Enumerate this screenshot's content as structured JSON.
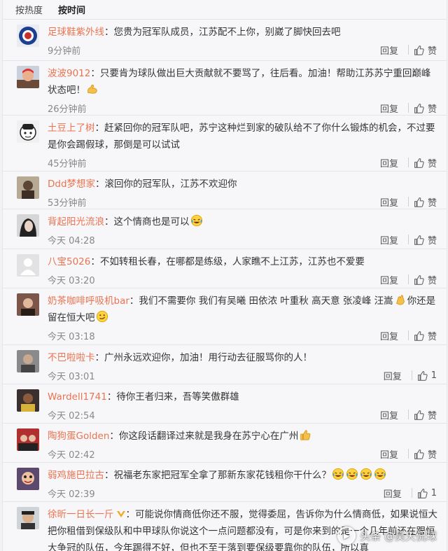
{
  "sort_tabs": [
    "按热度",
    "按时间"
  ],
  "labels": {
    "reply": "回复",
    "like": "赞"
  },
  "comments": [
    {
      "user": "足球鞋紫外线",
      "text": "您贵为冠军队成员，江苏配不上你，别崴了脚快回去吧",
      "time": "9分钟前",
      "likes": ""
    },
    {
      "user": "波波9012",
      "text": "只要肯为球队做出巨大贡献就不要骂了，往后看。加油！帮助江苏苏宁重回巅峰状态吧！",
      "time": "26分钟前",
      "likes": ""
    },
    {
      "user": "土豆上了树",
      "text": "赶紧回你的冠军队吧，苏宁这种烂到家的破队给不了你什么锻炼的机会，不过要是你会踢假球，那倒是可以试试",
      "time": "45分钟前",
      "likes": ""
    },
    {
      "user": "Ddd梦想家",
      "text": "滚回你的冠军队，江苏不欢迎你",
      "time": "53分钟前",
      "likes": ""
    },
    {
      "user": "背起阳光流浪",
      "text": "这个情商也是可以",
      "time": "今天 04:28",
      "likes": ""
    },
    {
      "user": "八宝5026",
      "text": "不如转租长春，在哪都是练级，人家瞧不上江苏，江苏也不爱要",
      "time": "今天 03:20",
      "likes": ""
    },
    {
      "user": "奶茶咖啡呼吸机bar",
      "text": "我们不需要你 我们有吴曦 田依浓 叶重秋 高天意 张凌峰 汪嵩",
      "text2": "你还是留在恒大吧",
      "time": "今天 03:18",
      "likes": ""
    },
    {
      "user": "不巴啦啦卡",
      "text": "广州永远欢迎你，加油！用行动去征服骂你的人！",
      "time": "今天 03:01",
      "likes": "1"
    },
    {
      "user": "Wardell1741",
      "text": "待你王者归来，吾等笑傲群雄",
      "time": "今天 02:54",
      "likes": ""
    },
    {
      "user": "陶狗蛋Golden",
      "text": "你这段话翻译过来就是我身在苏宁心在广州",
      "time": "今天 02:42",
      "likes": ""
    },
    {
      "user": "弱鸡施巴拉古",
      "text": "祝福老东家把冠军全拿了那新东家花钱租你干什么？",
      "time": "今天 02:39",
      "likes": "1"
    },
    {
      "user": "徐昕一日长一斤",
      "text": "可能说你情商低你还不服，觉得委屈，告诉你为什么情商低，如果说恒大把你租借到保级队和中甲球队你说这个一点问题都没有，可是你来到的是一个几年前还在跟恒大争冠的队伍，今年踢得不好，但也不至于落到要保级要靠你的队伍，所以真",
      "time": "",
      "likes": ""
    }
  ],
  "watermark": "头条 @昊天侃球",
  "colors": {
    "username": "#eb7350",
    "time": "#888888",
    "background": "#f7f7f9"
  }
}
